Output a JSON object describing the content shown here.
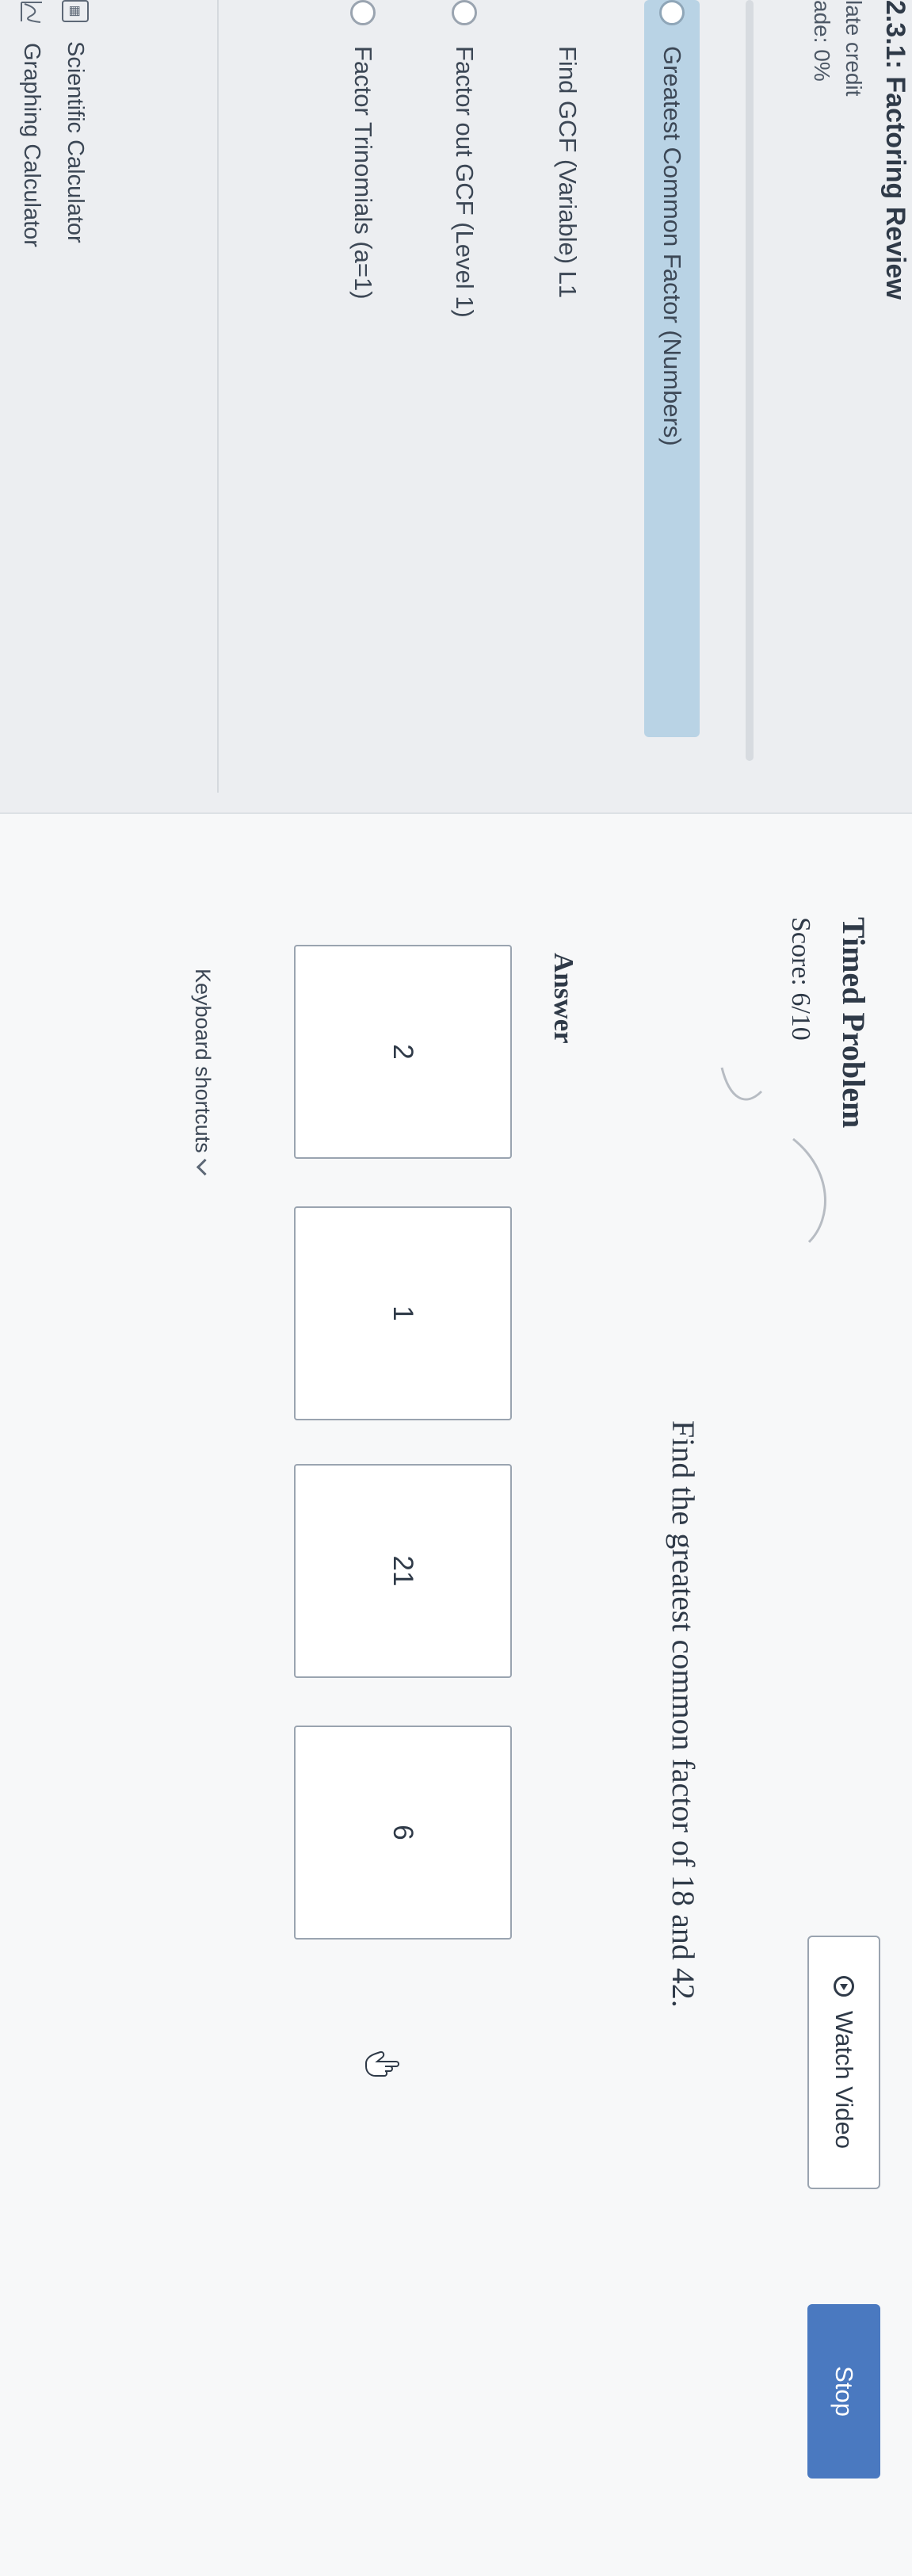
{
  "sidebar": {
    "course_title": "2.3.1: Factoring Review",
    "late_credit": "late credit",
    "grade": "ade: 0%",
    "progress_percent": 0,
    "skills": [
      {
        "label": "Greatest Common Factor (Numbers)",
        "active": true
      },
      {
        "label": "Find GCF (Variable) L1",
        "active": false
      },
      {
        "label": "Factor out GCF (Level 1)",
        "active": false
      },
      {
        "label": "Factor Trinomials (a=1)",
        "active": false
      }
    ],
    "tools": [
      {
        "label": "Scientific Calculator",
        "icon": "calculator-icon"
      },
      {
        "label": "Graphing Calculator",
        "icon": "graph-icon"
      }
    ]
  },
  "problem": {
    "title": "Timed Problem",
    "score": "Score: 6/10",
    "watch_video_label": "Watch Video",
    "stop_label": "Stop",
    "question": "Find the greatest common factor of 18 and 42.",
    "answer_heading": "Answer",
    "choices": [
      "2",
      "1",
      "21",
      "6"
    ],
    "keyboard_shortcuts_label": "Keyboard shortcuts"
  },
  "colors": {
    "accent": "#4a79c0",
    "active_item": "#b9d3e5",
    "text": "#2f3a48",
    "border": "#9aa4b0"
  }
}
